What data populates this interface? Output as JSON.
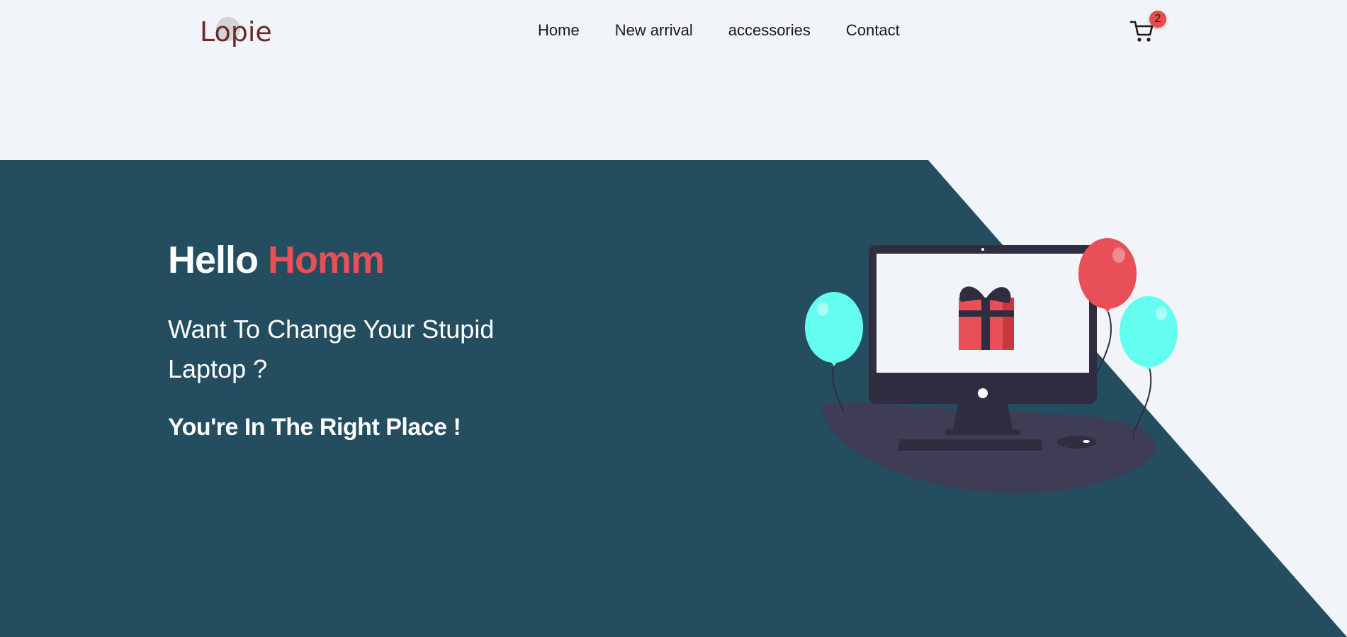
{
  "brand": {
    "logo_text": "Lopie"
  },
  "nav": {
    "items": [
      {
        "label": "Home"
      },
      {
        "label": "New arrival"
      },
      {
        "label": "accessories"
      },
      {
        "label": "Contact"
      }
    ]
  },
  "cart": {
    "count": "2",
    "icon": "cart-icon"
  },
  "hero": {
    "title_lead": "Hello ",
    "title_accent": "Homm",
    "subtitle": "Want To Change Your Stupid Laptop ?",
    "tagline": "You're In The Right Place !"
  },
  "colors": {
    "page_bg": "#f1f4f8",
    "hero_bg": "#244d60",
    "accent": "#e84f56",
    "logo": "#6b2a2a",
    "balloon_cyan": "#64fef0",
    "monitor": "#2f2d3f",
    "desk": "#3f3d56"
  }
}
